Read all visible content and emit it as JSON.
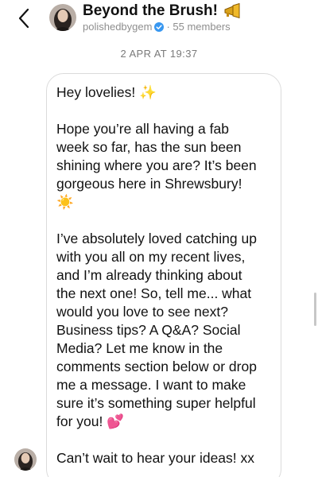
{
  "header": {
    "back_icon": "chevron-left-icon",
    "avatar_icon": "profile-photo",
    "title": "Beyond the Brush!",
    "title_emoji": "megaphone-icon",
    "handle": "polishedbygem",
    "verified_icon": "verified-badge-icon",
    "members": "· 55 members"
  },
  "thread": {
    "timestamp": "2 APR AT 19:37",
    "sender_avatar_icon": "profile-photo",
    "message_lines": [
      "Hey lovelies! ✨",
      "",
      "Hope you’re all having a fab",
      "week so far, has the sun been",
      "shining where you are? It’s been",
      "gorgeous here in Shrewsbury!",
      "☀️",
      "",
      "I’ve absolutely loved catching up",
      "with you all on my recent lives,",
      "and I’m already thinking about",
      "the next one! So, tell me... what",
      "would you love to see next?",
      "Business tips? A Q&A? Social",
      "Media? Let me know in the",
      "comments section below or drop",
      "me a message. I want to make",
      "sure it’s something super helpful",
      "for you! 💕",
      "",
      "Can’t wait to hear your ideas! xx"
    ]
  },
  "colors": {
    "accent_blue": "#3897f0",
    "bubble_border": "#dbdbdb",
    "secondary_text": "#8e8e8e"
  }
}
